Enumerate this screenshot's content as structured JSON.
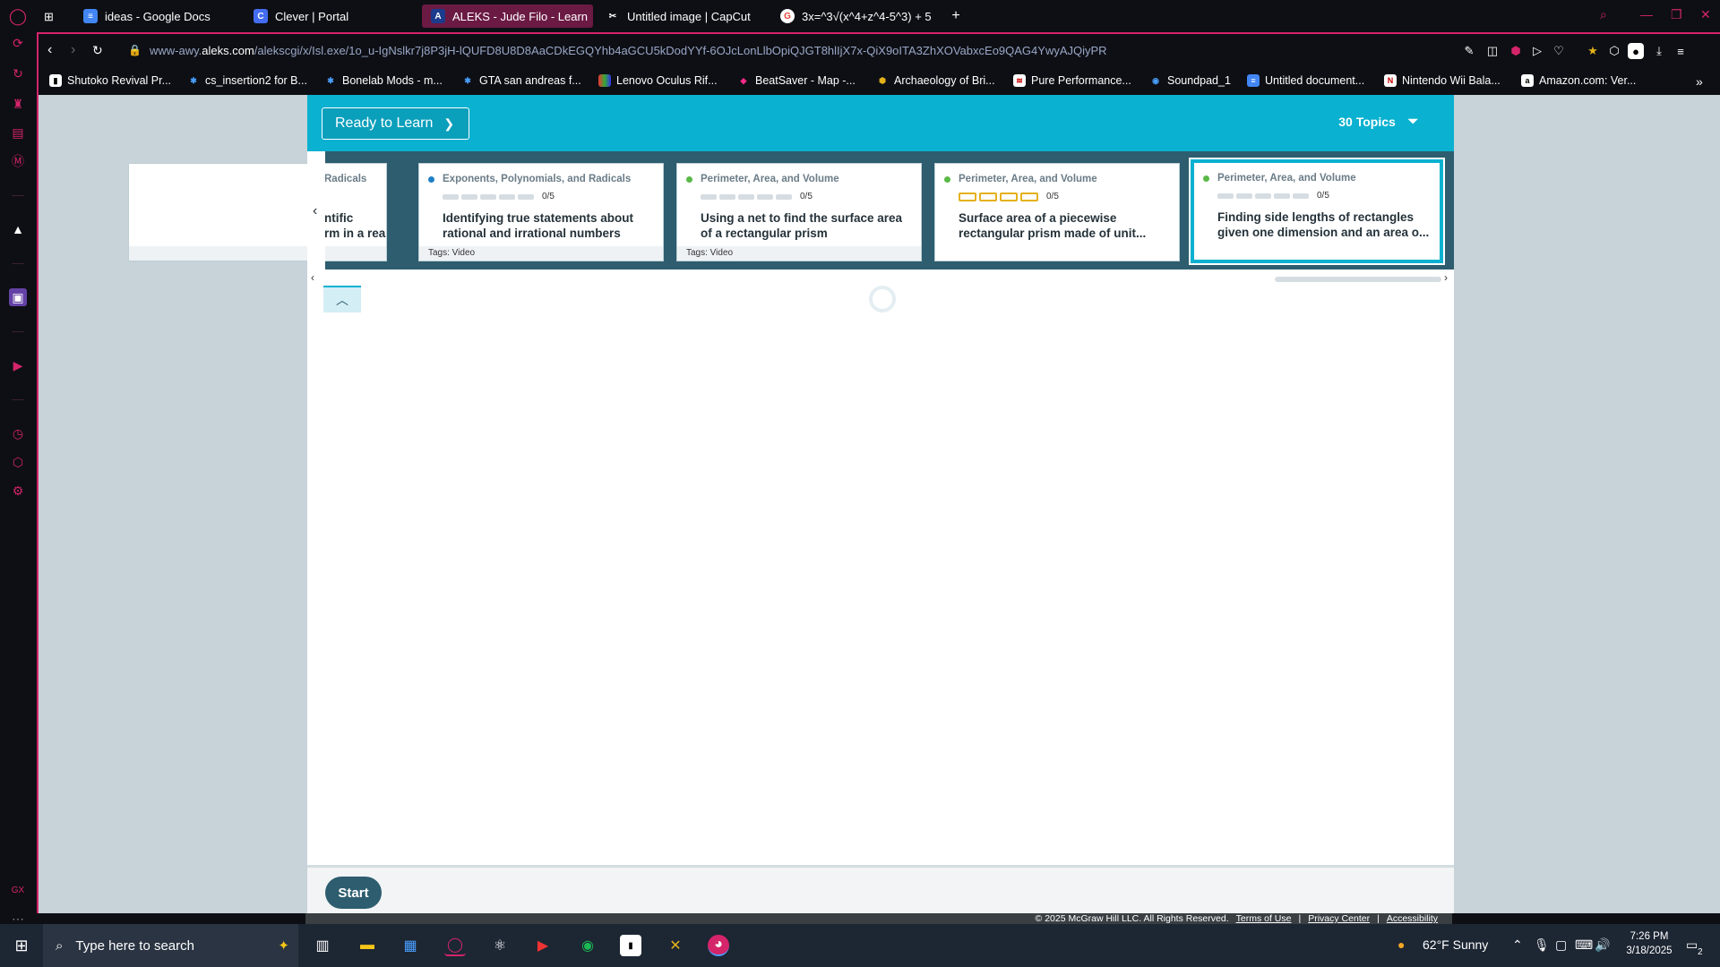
{
  "browser": {
    "tabs": [
      {
        "label": "ideas - Google Docs",
        "icon": "google-docs-icon",
        "color": "#4285f4"
      },
      {
        "label": "Clever | Portal",
        "icon": "clever-icon",
        "color": "#436cf2"
      },
      {
        "label": "ALEKS - Jude Filo - Learn",
        "icon": "aleks-icon",
        "color": "#1b3b8c",
        "active": true
      },
      {
        "label": "Untitled image | CapCut",
        "icon": "capcut-icon",
        "color": "#ffffff"
      },
      {
        "label": "3x=^3√(x^4+z^4-5^3) + 5",
        "icon": "google-icon",
        "color": "#ea4335"
      }
    ],
    "url_prefix": "www-awy.",
    "url_domain": "aleks.com",
    "url_path": "/alekscgi/x/Isl.exe/1o_u-IgNslkr7j8P3jH-lQUFD8U8D8AaCDkEGQYhb4aGCU5kDodYYf-6OJcLonLlbOpiQJGT8hlIjX7x-QiX9oITA3ZhXOVabxcEo9QAG4YwyAJQiyPR",
    "bookmarks": [
      {
        "label": "Shutoko Revival Pr...",
        "icon": "doc-icon"
      },
      {
        "label": "cs_insertion2 for B...",
        "icon": "gear-icon"
      },
      {
        "label": "Bonelab Mods - m...",
        "icon": "gear-icon"
      },
      {
        "label": "GTA san andreas f...",
        "icon": "gear-icon"
      },
      {
        "label": "Lenovo Oculus Rif...",
        "icon": "lenovo-icon"
      },
      {
        "label": "BeatSaver - Map -...",
        "icon": "beatsaver-icon"
      },
      {
        "label": "Archaeology of Bri...",
        "icon": "hex-icon"
      },
      {
        "label": "Pure Performance...",
        "icon": "flag-icon"
      },
      {
        "label": "Soundpad_1",
        "icon": "soundpad-icon"
      },
      {
        "label": "Untitled document...",
        "icon": "google-docs-icon"
      },
      {
        "label": "Nintendo Wii Bala...",
        "icon": "nintendo-icon"
      },
      {
        "label": "Amazon.com: Ver...",
        "icon": "amazon-icon"
      }
    ]
  },
  "aleks": {
    "dropdown_label": "Ready to Learn",
    "topics_label": "30 Topics",
    "partial_card": {
      "category": "Radicals",
      "title_line1": "ntific",
      "title_line2": "rm in a rea..."
    },
    "cards": [
      {
        "category": "Exponents, Polynomials, and Radicals",
        "dot_color": "#1f7fc4",
        "progress": "0/5",
        "progress_value": 0,
        "title": "Identifying true statements about rational and irrational numbers",
        "tags": "Tags: Video"
      },
      {
        "category": "Perimeter, Area, and Volume",
        "dot_color": "#5ab947",
        "progress": "0/5",
        "progress_value": 0,
        "title": "Using a net to find the surface area of a rectangular prism",
        "tags": "Tags: Video"
      },
      {
        "category": "Perimeter, Area, and Volume",
        "dot_color": "#5ab947",
        "progress": "0/5",
        "progress_value": 0,
        "title": "Surface area of a piecewise rectangular prism made of unit...",
        "tags": ""
      },
      {
        "category": "Perimeter, Area, and Volume",
        "dot_color": "#5ab947",
        "progress": "0/5",
        "progress_value": 0,
        "title": "Finding side lengths of rectangles given one dimension and an area o...",
        "tags": ""
      }
    ],
    "start_label": "Start",
    "copyright": "© 2025 McGraw Hill LLC. All Rights Reserved.",
    "terms": "Terms of Use",
    "privacy": "Privacy Center",
    "accessibility": "Accessibility"
  },
  "taskbar": {
    "search_placeholder": "Type here to search",
    "weather": "62°F  Sunny",
    "time": "7:26 PM",
    "date": "3/18/2025",
    "notifications": "2"
  }
}
